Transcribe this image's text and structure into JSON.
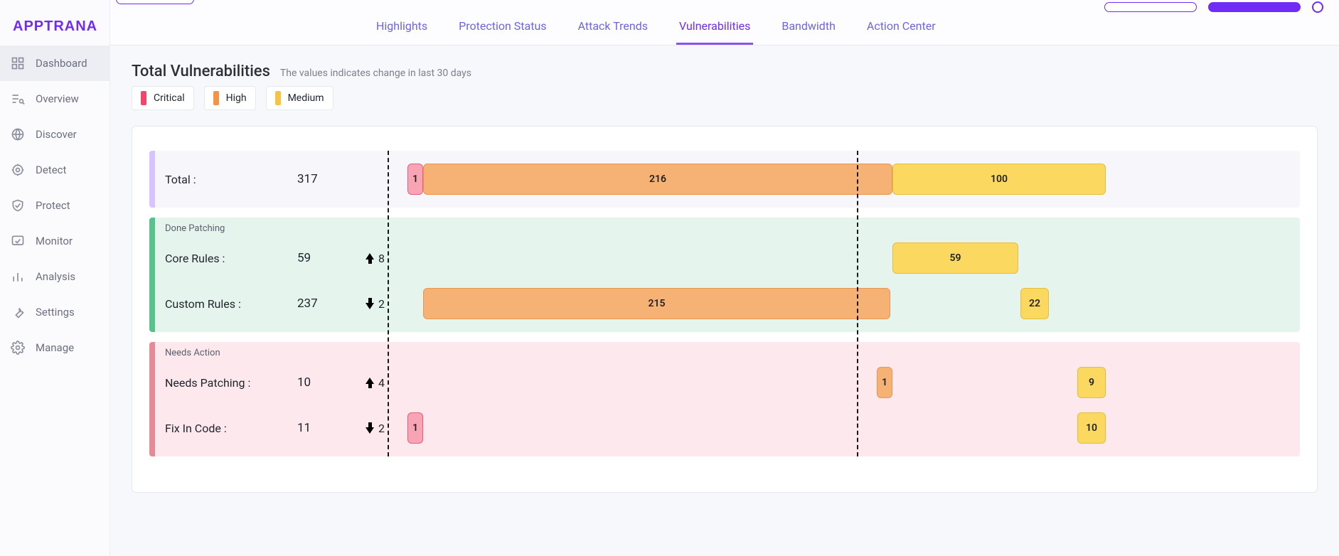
{
  "brand": "APPTRANA",
  "sidebar": {
    "items": [
      {
        "label": "Dashboard",
        "active": true
      },
      {
        "label": "Overview"
      },
      {
        "label": "Discover"
      },
      {
        "label": "Detect"
      },
      {
        "label": "Protect"
      },
      {
        "label": "Monitor"
      },
      {
        "label": "Analysis"
      },
      {
        "label": "Settings"
      },
      {
        "label": "Manage"
      }
    ]
  },
  "tabs": {
    "items": [
      {
        "label": "Highlights"
      },
      {
        "label": "Protection Status"
      },
      {
        "label": "Attack Trends"
      },
      {
        "label": "Vulnerabilities",
        "active": true
      },
      {
        "label": "Bandwidth"
      },
      {
        "label": "Action Center"
      }
    ]
  },
  "page": {
    "title": "Total Vulnerabilities",
    "subtitle": "The values indicates change in last 30 days"
  },
  "legend": {
    "critical": "Critical",
    "high": "High",
    "medium": "Medium"
  },
  "chart_data": {
    "type": "bar",
    "xlabel": "",
    "ylabel": "Count",
    "series_names": [
      "Critical",
      "High",
      "Medium"
    ],
    "rows": [
      {
        "section": "total",
        "label": "Total :",
        "count": 317,
        "delta": null,
        "critical": 1,
        "high": 216,
        "medium": 100
      },
      {
        "section": "done",
        "section_title": "Done Patching",
        "label": "Core Rules :",
        "count": 59,
        "delta": 8,
        "critical": 0,
        "high": 0,
        "medium": 59
      },
      {
        "section": "done",
        "label": "Custom Rules :",
        "count": 237,
        "delta": -2,
        "critical": 0,
        "high": 215,
        "medium": 22
      },
      {
        "section": "needs",
        "section_title": "Needs Action",
        "label": "Needs Patching :",
        "count": 10,
        "delta": 4,
        "critical": 0,
        "high": 1,
        "medium": 9
      },
      {
        "section": "needs",
        "label": "Fix In Code :",
        "count": 11,
        "delta": -2,
        "critical": 1,
        "high": 0,
        "medium": 10
      }
    ]
  }
}
